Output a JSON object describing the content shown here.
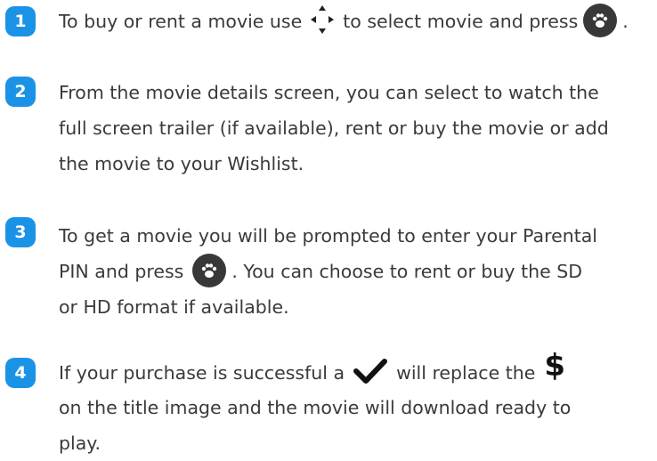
{
  "steps": [
    {
      "number": "1",
      "lines": [
        [
          "To buy or rent a movie use",
          "to select movie and press",
          "."
        ]
      ]
    },
    {
      "number": "2",
      "lines": [
        "From the movie details screen, you can select to watch the",
        "full screen trailer (if available), rent or buy the movie or add",
        "the movie to your Wishlist."
      ]
    },
    {
      "number": "3",
      "lines": [
        "To get a movie you will be prompted to enter your Parental",
        [
          "PIN and press",
          ". You can choose to rent or buy the SD"
        ],
        "or HD format if available."
      ]
    },
    {
      "number": "4",
      "lines": [
        [
          "If your purchase is successful a",
          "will replace the"
        ],
        "on the title image and the movie will download ready to",
        "play."
      ]
    }
  ],
  "icons": {
    "dpad": "dpad-arrows-icon",
    "ok": "paw-ok-button-icon",
    "check": "checkmark-icon",
    "dollar_glyph": "$"
  },
  "colors": {
    "badge": "#1a93e6",
    "text": "#3a3a3a",
    "ok_button": "#383838"
  }
}
